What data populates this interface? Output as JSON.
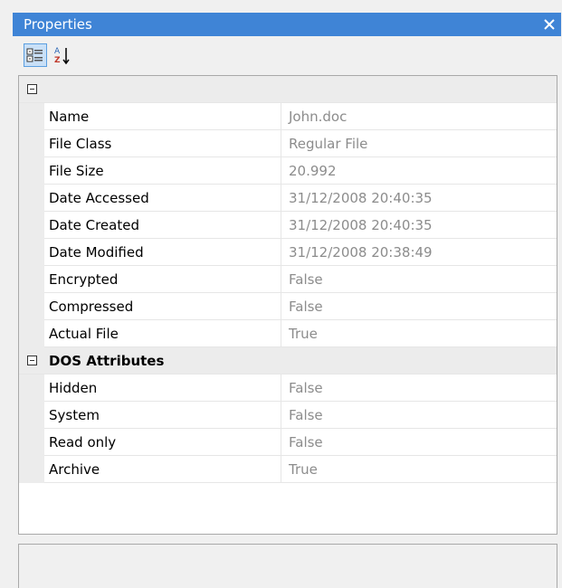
{
  "window": {
    "title": "Properties"
  },
  "toolbar": {
    "categorized_icon": "categorized-icon",
    "alphabetical_icon": "alphabetical-icon",
    "alphabetical_glyph_top": "A",
    "alphabetical_glyph_bottom": "Z"
  },
  "categories": [
    {
      "label": "",
      "properties": [
        {
          "name": "Name",
          "value": "John.doc"
        },
        {
          "name": "File Class",
          "value": "Regular File"
        },
        {
          "name": "File Size",
          "value": "20.992"
        },
        {
          "name": "Date Accessed",
          "value": "31/12/2008 20:40:35"
        },
        {
          "name": "Date Created",
          "value": "31/12/2008 20:40:35"
        },
        {
          "name": "Date Modified",
          "value": "31/12/2008 20:38:49"
        },
        {
          "name": "Encrypted",
          "value": "False"
        },
        {
          "name": "Compressed",
          "value": "False"
        },
        {
          "name": "Actual File",
          "value": "True"
        }
      ]
    },
    {
      "label": "DOS Attributes",
      "properties": [
        {
          "name": "Hidden",
          "value": "False"
        },
        {
          "name": "System",
          "value": "False"
        },
        {
          "name": "Read only",
          "value": "False"
        },
        {
          "name": "Archive",
          "value": "True"
        }
      ]
    }
  ],
  "colors": {
    "titlebar": "#3f84d6",
    "value_text": "#8c8c8c",
    "category_bg": "#ececec"
  }
}
